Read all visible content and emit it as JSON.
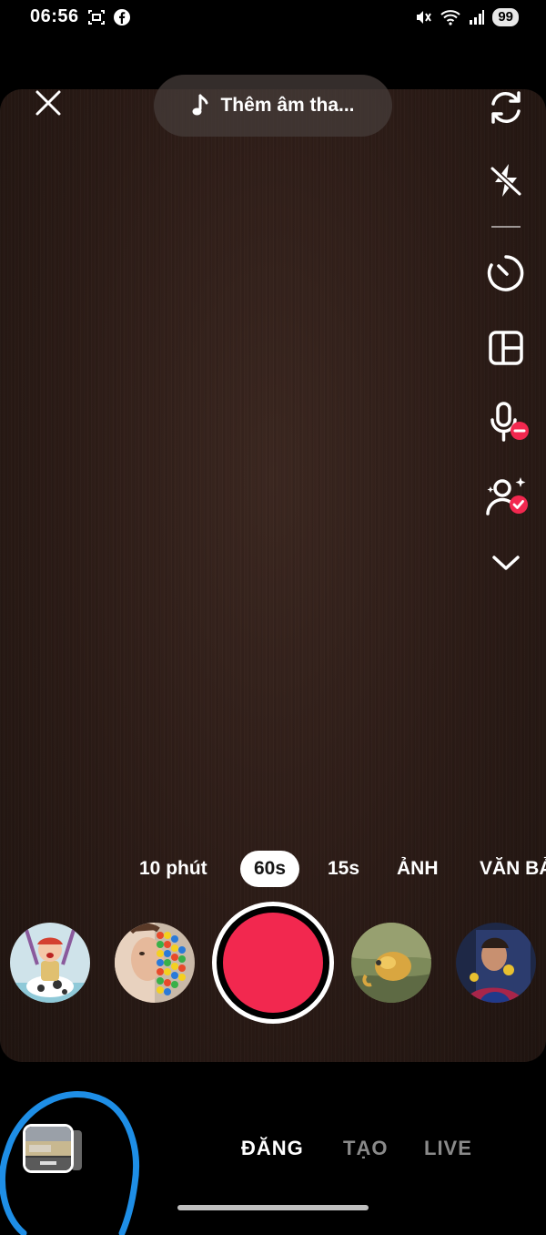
{
  "status_bar": {
    "time": "06:56",
    "battery": "99"
  },
  "top": {
    "add_sound_label": "Thêm âm tha..."
  },
  "right_tools": [
    "flip-camera-icon",
    "flash-off-icon",
    "timer-icon",
    "layout-icon",
    "mic-off-icon",
    "face-retouch-icon",
    "chevron-down-icon"
  ],
  "modes": {
    "m10": "10 phút",
    "m60": "60s",
    "m15": "15s",
    "photo": "ẢNH",
    "text": "VĂN BẢ"
  },
  "bottom_nav": {
    "post": "ĐĂNG",
    "create": "TẠO",
    "live": "LIVE"
  },
  "colors": {
    "accent_red": "#f2284f",
    "highlight_blue": "#1e8ee6",
    "inactive_tab": "#8a8a8a"
  }
}
